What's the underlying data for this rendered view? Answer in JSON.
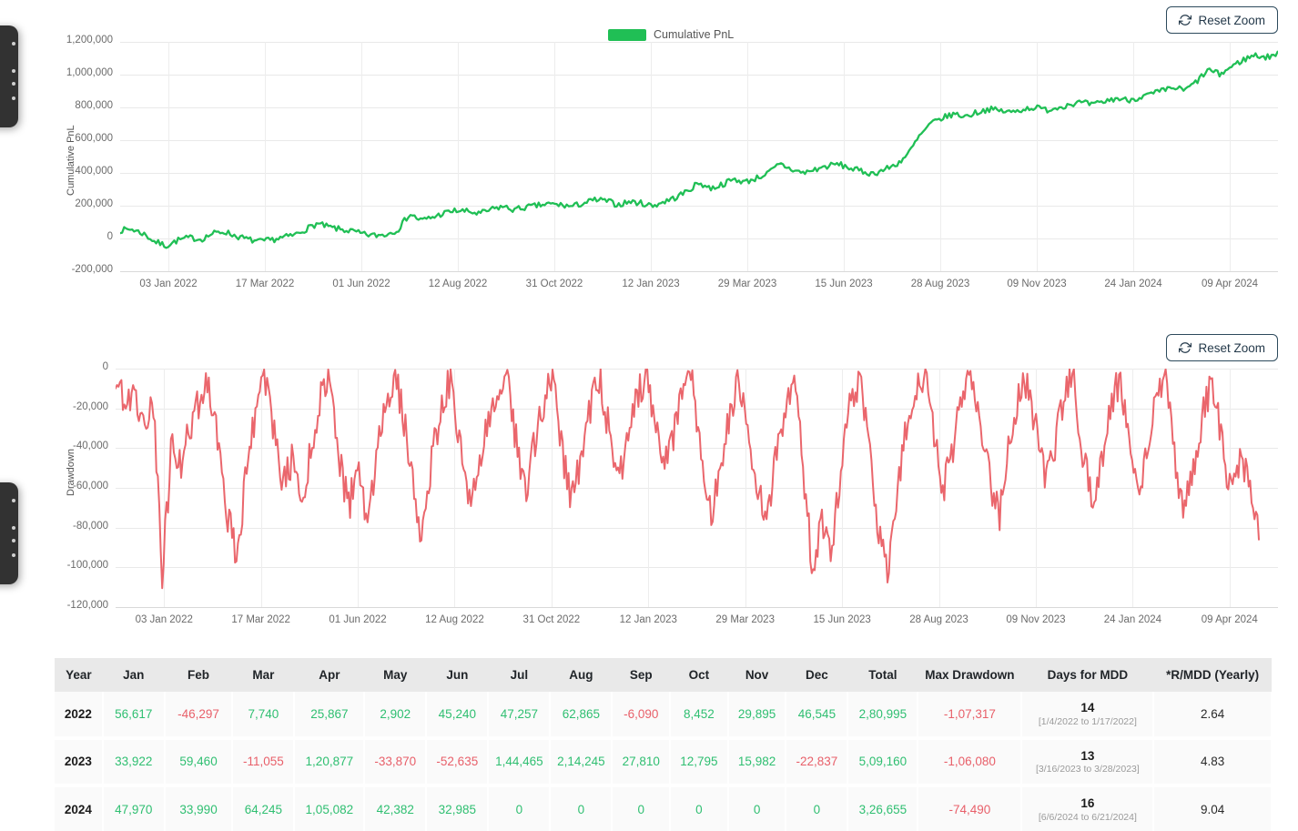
{
  "colors": {
    "pnl_line": "#20bf55",
    "drawdown_line": "#e8595f",
    "positive_text": "#2fbf71",
    "negative_text": "#e8606a",
    "button_border": "#2d4a5c",
    "grid": "#e9e9e9",
    "header_bg": "#e9e9e9"
  },
  "buttons": {
    "reset_zoom_top": "Reset Zoom",
    "reset_zoom_bottom": "Reset Zoom",
    "icon": "refresh-icon"
  },
  "legend": {
    "label": "Cumulative PnL",
    "swatch_color": "#20bf55"
  },
  "chart_data": [
    {
      "type": "line",
      "name": "cumulative-pnl-chart",
      "title": "",
      "ylabel": "Cumulative PnL",
      "xlabel": "",
      "legend": [
        "Cumulative PnL"
      ],
      "legend_position": "top-center",
      "grid": true,
      "ylim": [
        -200000,
        1200000
      ],
      "yticks": [
        1200000,
        1000000,
        800000,
        600000,
        400000,
        200000,
        0,
        -200000
      ],
      "ytick_labels": [
        "1,200,000",
        "1,000,000",
        "800,000",
        "600,000",
        "400,000",
        "200,000",
        "0",
        "-200,000"
      ],
      "xtick_labels": [
        "03 Jan 2022",
        "17 Mar 2022",
        "01 Jun 2022",
        "12 Aug 2022",
        "31 Oct 2022",
        "12 Jan 2023",
        "29 Mar 2023",
        "15 Jun 2023",
        "28 Aug 2023",
        "09 Nov 2023",
        "24 Jan 2024",
        "09 Apr 2024"
      ],
      "series": [
        {
          "name": "Cumulative PnL",
          "color": "#20bf55",
          "anchors_x": [
            0,
            0.01,
            0.02,
            0.03,
            0.04,
            0.05,
            0.06,
            0.07,
            0.08,
            0.09,
            0.1,
            0.11,
            0.12,
            0.13,
            0.14,
            0.15,
            0.16,
            0.17,
            0.18,
            0.19,
            0.2,
            0.21,
            0.22,
            0.23,
            0.24,
            0.25,
            0.26,
            0.27,
            0.28,
            0.29,
            0.3,
            0.31,
            0.32,
            0.33,
            0.34,
            0.35,
            0.36,
            0.37,
            0.38,
            0.39,
            0.4,
            0.41,
            0.42,
            0.43,
            0.44,
            0.45,
            0.46,
            0.47,
            0.48,
            0.49,
            0.5,
            0.51,
            0.52,
            0.53,
            0.54,
            0.55,
            0.56,
            0.57,
            0.58,
            0.59,
            0.6,
            0.61,
            0.62,
            0.63,
            0.64,
            0.65,
            0.66,
            0.67,
            0.68,
            0.69,
            0.7,
            0.71,
            0.72,
            0.73,
            0.74,
            0.75,
            0.76,
            0.77,
            0.78,
            0.79,
            0.8,
            0.81,
            0.82,
            0.83,
            0.84,
            0.85,
            0.86,
            0.87,
            0.88,
            0.89,
            0.9,
            0.91,
            0.92,
            0.93,
            0.94,
            0.95,
            0.96,
            0.97,
            0.98,
            0.99,
            1.0
          ],
          "anchors_y": [
            50000,
            57000,
            30000,
            -20000,
            -45000,
            -10000,
            5000,
            -5000,
            30000,
            42000,
            15000,
            -5000,
            -20000,
            -10000,
            5000,
            20000,
            55000,
            90000,
            70000,
            55000,
            45000,
            25000,
            18000,
            25000,
            55000,
            150000,
            110000,
            130000,
            155000,
            170000,
            165000,
            150000,
            175000,
            195000,
            175000,
            190000,
            200000,
            210000,
            205000,
            195000,
            215000,
            235000,
            230000,
            205000,
            225000,
            215000,
            200000,
            225000,
            250000,
            290000,
            340000,
            305000,
            330000,
            360000,
            345000,
            370000,
            400000,
            455000,
            420000,
            400000,
            420000,
            440000,
            455000,
            430000,
            410000,
            395000,
            420000,
            450000,
            510000,
            620000,
            700000,
            735000,
            760000,
            745000,
            770000,
            790000,
            780000,
            770000,
            790000,
            800000,
            785000,
            800000,
            820000,
            830000,
            815000,
            835000,
            855000,
            845000,
            860000,
            880000,
            900000,
            920000,
            905000,
            960000,
            1030000,
            1000000,
            1050000,
            1090000,
            1120000,
            1105000,
            1130000
          ],
          "noise_amp": 18000,
          "noise_seed": 7
        }
      ]
    },
    {
      "type": "line",
      "name": "drawdown-chart",
      "title": "",
      "ylabel": "Drawdown",
      "xlabel": "",
      "grid": true,
      "ylim": [
        -120000,
        0
      ],
      "yticks": [
        0,
        -20000,
        -40000,
        -60000,
        -80000,
        -100000,
        -120000
      ],
      "ytick_labels": [
        "0",
        "-20,000",
        "-40,000",
        "-60,000",
        "-80,000",
        "-100,000",
        "-120,000"
      ],
      "xtick_labels": [
        "03 Jan 2022",
        "17 Mar 2022",
        "01 Jun 2022",
        "12 Aug 2022",
        "31 Oct 2022",
        "12 Jan 2023",
        "29 Mar 2023",
        "15 Jun 2023",
        "28 Aug 2023",
        "09 Nov 2023",
        "24 Jan 2024",
        "09 Apr 2024"
      ],
      "series": [
        {
          "name": "Drawdown",
          "color": "#e8595f",
          "anchors_x": [
            0,
            0.008,
            0.016,
            0.024,
            0.032,
            0.04,
            0.048,
            0.056,
            0.064,
            0.072,
            0.08,
            0.088,
            0.096,
            0.104,
            0.112,
            0.12,
            0.128,
            0.136,
            0.144,
            0.152,
            0.16,
            0.168,
            0.176,
            0.184,
            0.192,
            0.2,
            0.208,
            0.216,
            0.224,
            0.232,
            0.24,
            0.248,
            0.256,
            0.264,
            0.272,
            0.28,
            0.288,
            0.296,
            0.304,
            0.312,
            0.32,
            0.328,
            0.336,
            0.344,
            0.352,
            0.36,
            0.368,
            0.376,
            0.384,
            0.392,
            0.4,
            0.408,
            0.416,
            0.424,
            0.432,
            0.44,
            0.448,
            0.456,
            0.464,
            0.472,
            0.48,
            0.488,
            0.496,
            0.504,
            0.512,
            0.52,
            0.528,
            0.536,
            0.544,
            0.552,
            0.56,
            0.568,
            0.576,
            0.584,
            0.592,
            0.6,
            0.608,
            0.616,
            0.624,
            0.632,
            0.64,
            0.648,
            0.656,
            0.664,
            0.672,
            0.68,
            0.688,
            0.696,
            0.704,
            0.712,
            0.72,
            0.728,
            0.736,
            0.744,
            0.752,
            0.76,
            0.768,
            0.776,
            0.784,
            0.792,
            0.8,
            0.808,
            0.816,
            0.824,
            0.832,
            0.84,
            0.848,
            0.856,
            0.864,
            0.872,
            0.88,
            0.888,
            0.896,
            0.904,
            0.912,
            0.92,
            0.928,
            0.936,
            0.944,
            0.952,
            0.96,
            0.968,
            0.976,
            0.984,
            0.992,
            1.0
          ],
          "anchors_y": [
            -2000,
            -22000,
            -8000,
            -30000,
            -12000,
            -105000,
            -40000,
            -48000,
            -30000,
            -15000,
            -5000,
            -35000,
            -72000,
            -95000,
            -55000,
            -22000,
            -3000,
            -30000,
            -60000,
            -45000,
            -70000,
            -40000,
            -15000,
            -5000,
            -42000,
            -70000,
            -52000,
            -78000,
            -48000,
            -18000,
            -3000,
            -25000,
            -60000,
            -85000,
            -45000,
            -20000,
            -5000,
            -38000,
            -70000,
            -52000,
            -28000,
            -8000,
            -2000,
            -35000,
            -62000,
            -40000,
            -18000,
            -5000,
            -40000,
            -68000,
            -45000,
            -20000,
            -4000,
            -30000,
            -55000,
            -38000,
            -15000,
            -3000,
            -28000,
            -50000,
            -32000,
            -12000,
            -4000,
            -45000,
            -75000,
            -50000,
            -22000,
            -6000,
            -35000,
            -60000,
            -80000,
            -45000,
            -18000,
            -4000,
            -55000,
            -103000,
            -75000,
            -95000,
            -50000,
            -18000,
            -4000,
            -40000,
            -78000,
            -100000,
            -65000,
            -30000,
            -8000,
            -2000,
            -35000,
            -62000,
            -40000,
            -15000,
            -3000,
            -28000,
            -55000,
            -75000,
            -42000,
            -18000,
            -5000,
            -30000,
            -58000,
            -38000,
            -12000,
            -3000,
            -42000,
            -68000,
            -45000,
            -20000,
            -5000,
            -35000,
            -60000,
            -38000,
            -15000,
            -4000,
            -50000,
            -72000,
            -48000,
            -22000,
            -6000,
            -40000,
            -65000,
            -45000,
            -60000,
            -80000
          ],
          "noise_amp": 9000,
          "noise_seed": 19
        }
      ]
    }
  ],
  "table": {
    "columns": [
      "Year",
      "Jan",
      "Feb",
      "Mar",
      "Apr",
      "May",
      "Jun",
      "Jul",
      "Aug",
      "Sep",
      "Oct",
      "Nov",
      "Dec",
      "Total",
      "Max Drawdown",
      "Days for MDD",
      "*R/MDD (Yearly)"
    ],
    "rows": [
      {
        "year": "2022",
        "months": [
          "56,617",
          "-46,297",
          "7,740",
          "25,867",
          "2,902",
          "45,240",
          "47,257",
          "62,865",
          "-6,090",
          "8,452",
          "29,895",
          "46,545"
        ],
        "total": "2,80,995",
        "max_drawdown": "-1,07,317",
        "mdd_days": "14",
        "mdd_range": "[1/4/2022 to 1/17/2022]",
        "r_mdd": "2.64"
      },
      {
        "year": "2023",
        "months": [
          "33,922",
          "59,460",
          "-11,055",
          "1,20,877",
          "-33,870",
          "-52,635",
          "1,44,465",
          "2,14,245",
          "27,810",
          "12,795",
          "15,982",
          "-22,837"
        ],
        "total": "5,09,160",
        "max_drawdown": "-1,06,080",
        "mdd_days": "13",
        "mdd_range": "[3/16/2023 to 3/28/2023]",
        "r_mdd": "4.83"
      },
      {
        "year": "2024",
        "months": [
          "47,970",
          "33,990",
          "64,245",
          "1,05,082",
          "42,382",
          "32,985",
          "0",
          "0",
          "0",
          "0",
          "0",
          "0"
        ],
        "total": "3,26,655",
        "max_drawdown": "-74,490",
        "mdd_days": "16",
        "mdd_range": "[6/6/2024 to 6/21/2024]",
        "r_mdd": "9.04"
      }
    ]
  }
}
